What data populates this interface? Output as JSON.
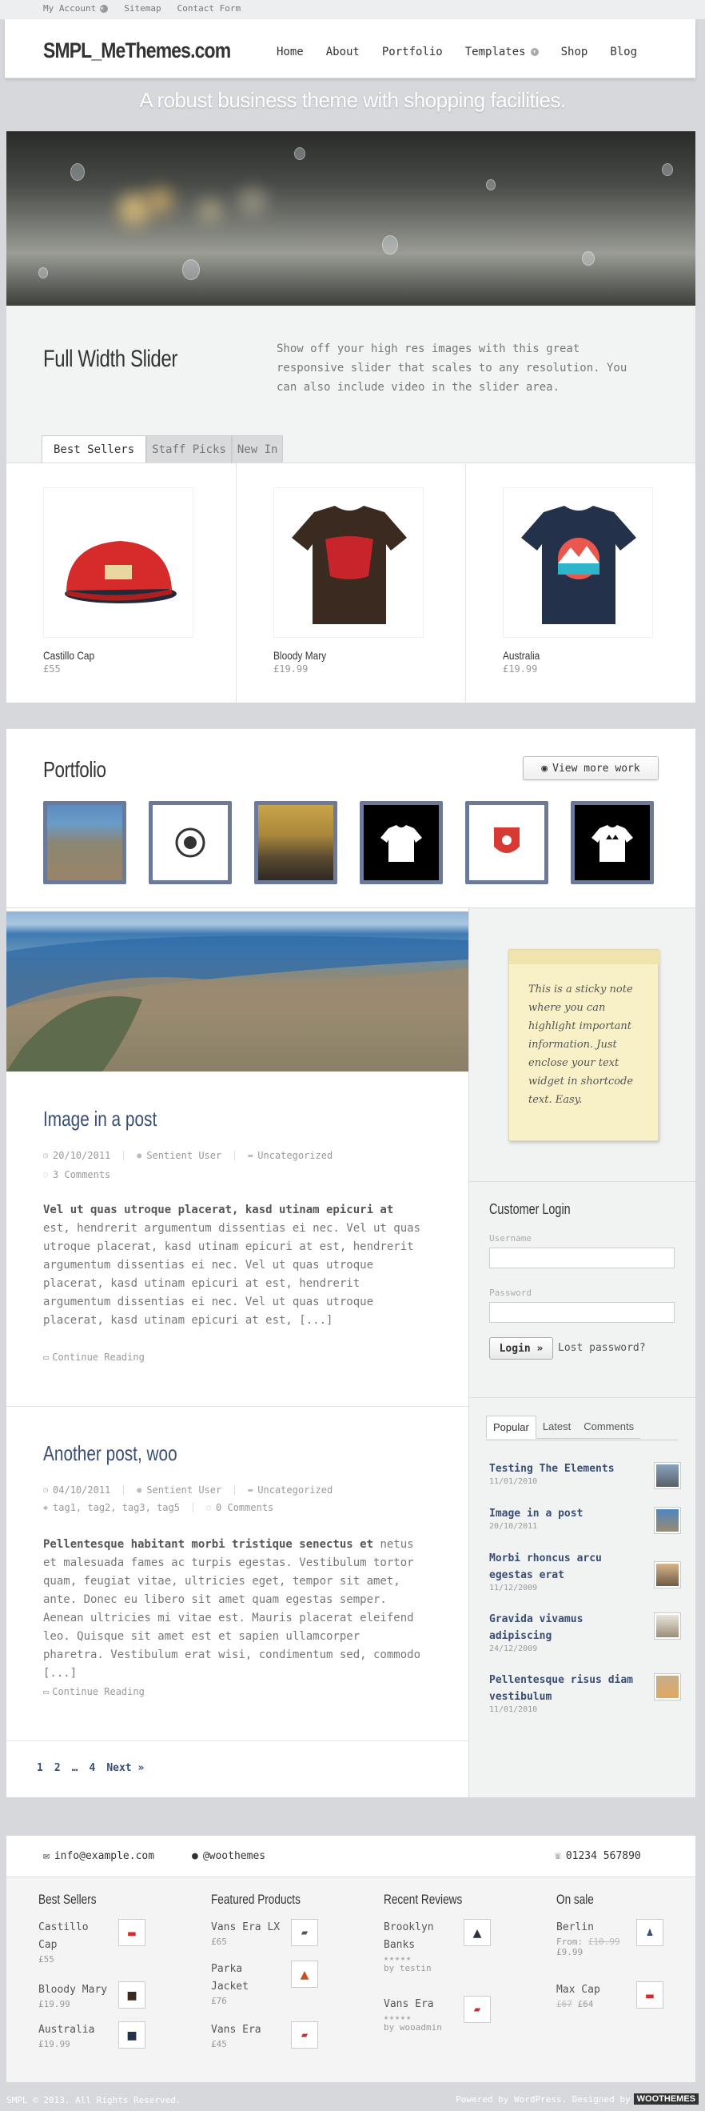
{
  "topbar": {
    "links": [
      {
        "label": "My Account",
        "has_icon": true
      },
      {
        "label": "Sitemap",
        "has_icon": false
      },
      {
        "label": "Contact Form",
        "has_icon": false
      }
    ]
  },
  "header": {
    "logo": "SMPL_MeThemes.com",
    "nav": [
      "Home",
      "About",
      "Portfolio",
      "Templates",
      "Shop",
      "Blog"
    ],
    "tagline": "A robust business theme with shopping facilities."
  },
  "intro": {
    "title": "Full Width Slider",
    "text": "Show off your high res images with this great responsive slider that scales to any resolution. You can also include video in the slider area."
  },
  "shop_tabs": [
    "Best Sellers",
    "Staff Picks",
    "New In"
  ],
  "products": [
    {
      "name": "Castillo Cap",
      "price": "£55"
    },
    {
      "name": "Bloody Mary",
      "price": "£19.99"
    },
    {
      "name": "Australia",
      "price": "£19.99"
    }
  ],
  "portfolio": {
    "title": "Portfolio",
    "view_more": "View more work"
  },
  "posts": [
    {
      "title": "Image in a post",
      "date": "20/10/2011",
      "author": "Sentient User",
      "category": "Uncategorized",
      "comments": "3 Comments",
      "excerpt_bold": "Vel ut quas utroque placerat, kasd utinam epicuri at",
      "excerpt": "est, hendrerit argumentum dissentias ei nec. Vel ut quas utroque placerat, kasd utinam epicuri at est, hendrerit argumentum dissentias ei nec. Vel ut quas utroque placerat, kasd utinam epicuri at est, hendrerit argumentum dissentias ei nec. Vel ut quas utroque placerat, kasd utinam epicuri at est, [...]",
      "more": "Continue Reading"
    },
    {
      "title": "Another post, woo",
      "date": "04/10/2011",
      "author": "Sentient User",
      "category": "Uncategorized",
      "tags": "tag1, tag2, tag3, tag5",
      "comments": "0 Comments",
      "excerpt_bold": "Pellentesque habitant morbi tristique senectus et",
      "excerpt": "netus et malesuada fames ac turpis egestas. Vestibulum tortor quam, feugiat vitae, ultricies eget, tempor sit amet, ante. Donec eu libero sit amet quam egestas semper. Aenean ultricies mi vitae est. Mauris placerat eleifend leo. Quisque sit amet est et sapien ullamcorper pharetra. Vestibulum erat wisi, condimentum sed, commodo [...]",
      "more": "Continue Reading"
    }
  ],
  "pagination": [
    "1",
    "2",
    "…",
    "4",
    "Next »"
  ],
  "sticky_note": "This is a sticky note where you can highlight important information. Just enclose your text widget in shortcode text. Easy.",
  "login": {
    "title": "Customer Login",
    "username_label": "Username",
    "password_label": "Password",
    "button": "Login »",
    "lost": "Lost password?"
  },
  "tab_widget": {
    "tabs": [
      "Popular",
      "Latest",
      "Comments"
    ],
    "items": [
      {
        "title": "Testing The Elements",
        "date": "11/01/2010"
      },
      {
        "title": "Image in a post",
        "date": "20/10/2011"
      },
      {
        "title": "Morbi rhoncus arcu egestas erat",
        "date": "11/12/2009"
      },
      {
        "title": "Gravida vivamus adipiscing",
        "date": "24/12/2009"
      },
      {
        "title": "Pellentesque risus diam vestibulum",
        "date": "11/01/2010"
      }
    ]
  },
  "contact": {
    "email": "info@example.com",
    "twitter": "@woothemes",
    "phone": "01234 567890"
  },
  "footer_widgets": {
    "best_sellers": {
      "title": "Best Sellers",
      "items": [
        {
          "name": "Castillo Cap",
          "price": "£55"
        },
        {
          "name": "Bloody Mary",
          "price": "£19.99"
        },
        {
          "name": "Australia",
          "price": "£19.99"
        }
      ]
    },
    "featured": {
      "title": "Featured Products",
      "items": [
        {
          "name": "Vans Era LX",
          "price": "£65"
        },
        {
          "name": "Parka Jacket",
          "price": "£76"
        },
        {
          "name": "Vans Era",
          "price": "£45"
        }
      ]
    },
    "reviews": {
      "title": "Recent Reviews",
      "items": [
        {
          "name": "Brooklyn Banks",
          "by": "by testin"
        },
        {
          "name": "Vans Era",
          "by": "by wooadmin"
        }
      ]
    },
    "onsale": {
      "title": "On sale",
      "items": [
        {
          "name": "Berlin",
          "from": "From:",
          "old": "£10.99",
          "price": "£9.99"
        },
        {
          "name": "Max Cap",
          "old": "£67",
          "price": "£64"
        }
      ]
    }
  },
  "copyright": {
    "left": "SMPL © 2013. All Rights Reserved.",
    "right": "Powered by WordPress. Designed by",
    "brand": "WOOTHEMES"
  }
}
